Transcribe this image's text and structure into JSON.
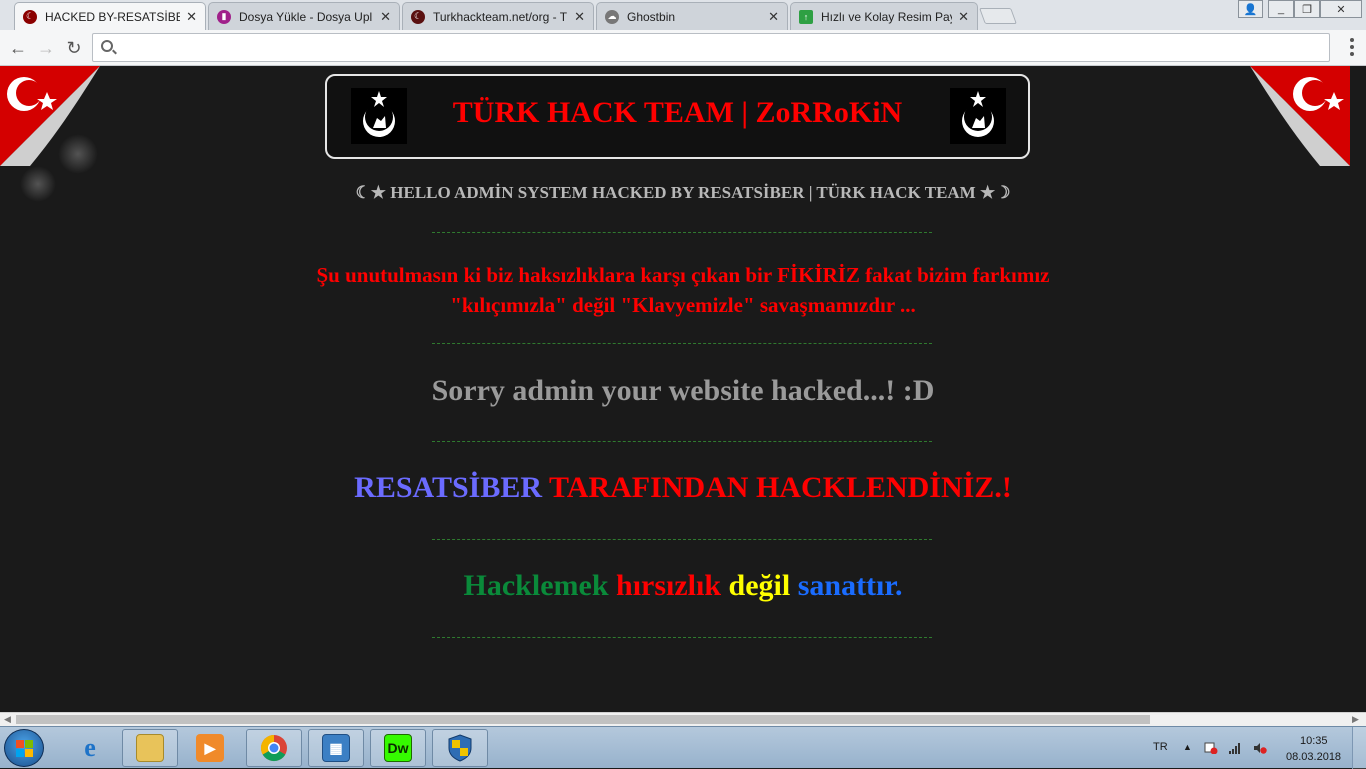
{
  "browser": {
    "tabs": [
      {
        "title": "HACKED BY-RESATSİBER",
        "active": true,
        "icon": "turkhackteam-icon"
      },
      {
        "title": "Dosya Yükle - Dosya Upl",
        "active": false,
        "icon": "dosya-upload-icon"
      },
      {
        "title": "Turkhackteam.net/org - T",
        "active": false,
        "icon": "turkhackteam-icon"
      },
      {
        "title": "Ghostbin",
        "active": false,
        "icon": "ghost-icon"
      },
      {
        "title": "Hızlı ve Kolay Resim Payl",
        "active": false,
        "icon": "image-upload-icon"
      }
    ],
    "close_glyph": "✕",
    "address": {
      "value": "",
      "placeholder": ""
    }
  },
  "page": {
    "banner_title": "TÜRK HACK TEAM | ZoRRoKiN",
    "hello_line": "☾★ HELLO ADMİN SYSTEM HACKED BY RESATSİBER | TÜRK HACK TEAM ★☽",
    "warning_line1": "Şu unutulmasın ki biz haksızlıklara karşı çıkan bir FİKİRİZ fakat bizim farkımız",
    "warning_line2": "\"kılıçımızla\" değil \"Klavyemizle\" savaşmamızdır ...",
    "sorry_line": "Sorry admin your website hacked...! :D",
    "hacked_name": "RESATSİBER",
    "hacked_rest": "TARAFINDAN HACKLENDİNİZ.!",
    "motto": [
      {
        "text": "Hacklemek",
        "color": "#0a8a3a"
      },
      {
        "text": "hırsızlık",
        "color": "#ff0000"
      },
      {
        "text": "değil",
        "color": "#ffff00"
      },
      {
        "text": "sanattır.",
        "color": "#1a6cff"
      }
    ],
    "colors": {
      "name": "#6b6bff",
      "red": "#ff0000",
      "grey": "#9a9a9a"
    }
  },
  "taskbar": {
    "apps": [
      "internet-explorer-icon",
      "file-explorer-icon",
      "media-player-icon",
      "chrome-icon",
      "control-panel-icon",
      "dreamweaver-icon",
      "windows-security-icon"
    ],
    "dreamweaver_label": "Dw",
    "language": "TR",
    "time": "10:35",
    "date": "08.03.2018"
  }
}
